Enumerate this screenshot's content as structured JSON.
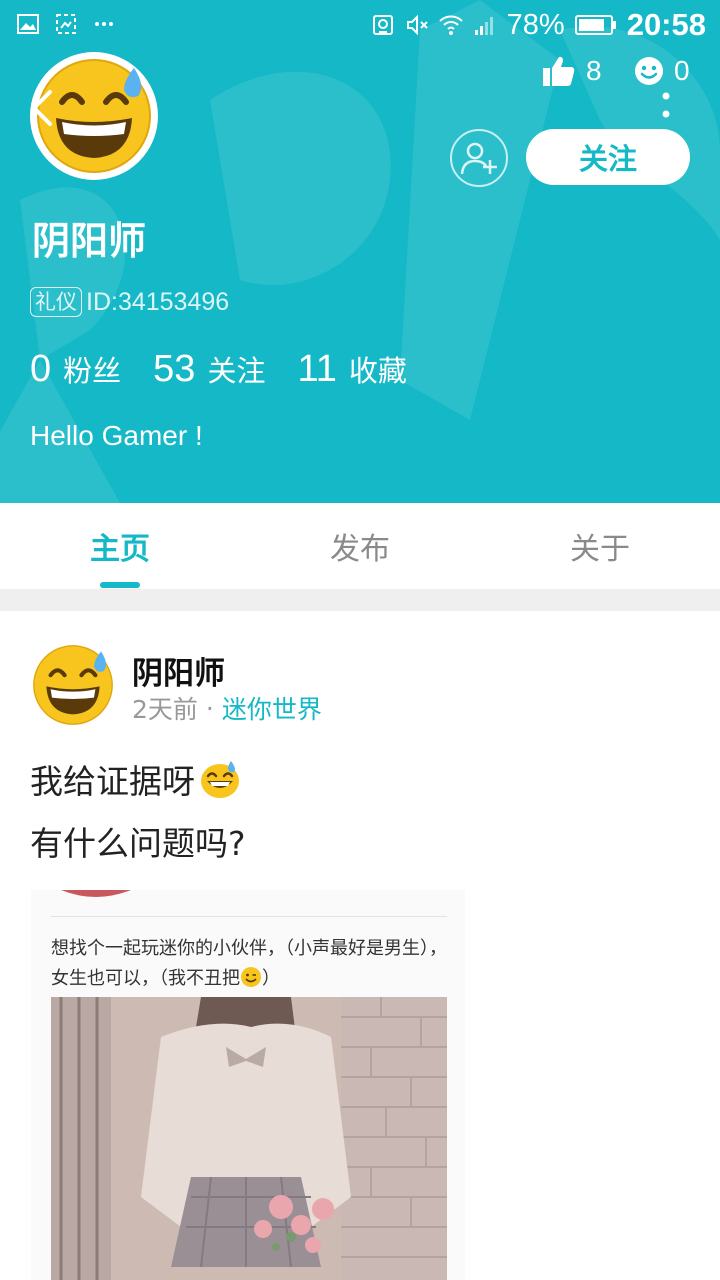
{
  "status_bar": {
    "left_icons": [
      "image-icon",
      "screenshot-icon",
      "more-notifications-icon"
    ],
    "right_icons": [
      "nfc-icon",
      "mute-icon",
      "wifi-icon",
      "signal-icon",
      "battery-icon"
    ],
    "battery": "78%",
    "time": "20:58"
  },
  "profile": {
    "name": "阴阳师",
    "badge": "礼仪",
    "id_text": "ID:34153496",
    "likes": "8",
    "messages": "0",
    "follow_button": "关注",
    "bio": "Hello Gamer !",
    "counts": [
      {
        "num": "0",
        "label": "粉丝"
      },
      {
        "num": "53",
        "label": "关注"
      },
      {
        "num": "11",
        "label": "收藏"
      }
    ]
  },
  "tabs": [
    {
      "label": "主页",
      "active": true
    },
    {
      "label": "发布",
      "active": false
    },
    {
      "label": "关于",
      "active": false
    }
  ],
  "post": {
    "author": "阴阳师",
    "time": "2天前",
    "separator": "·",
    "topic": "迷你世界",
    "line1": "我给证据呀",
    "line2": "有什么问题吗?",
    "image_caption": "想找个一起玩迷你的小伙伴，（小声最好是男生），女生也可以，（我不丑把",
    "image_caption_end": "）"
  },
  "colors": {
    "accent": "#14b8c6",
    "header_bg": "#14b8c6",
    "separator": "#efefef"
  }
}
